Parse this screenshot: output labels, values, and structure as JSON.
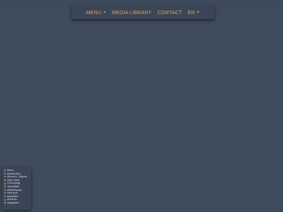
{
  "topnav": {
    "items": [
      {
        "label": "MENU",
        "has_dropdown": true
      },
      {
        "label": "MEDIA LIBRARY",
        "has_dropdown": false
      },
      {
        "label": "CONTACT",
        "has_dropdown": false
      },
      {
        "label": "EN",
        "has_dropdown": true
      }
    ]
  },
  "sidenav": {
    "items": [
      {
        "label": "Menu"
      },
      {
        "label": "Introduction"
      },
      {
        "label": "Morocco - Algeria"
      },
      {
        "label": "Open letter"
      },
      {
        "label": "Chronology"
      },
      {
        "label": "Journalists"
      },
      {
        "label": "Mediatheque"
      },
      {
        "label": "Next post"
      },
      {
        "label": "Actualités"
      },
      {
        "label": "Archives"
      },
      {
        "label": "Navigation"
      }
    ]
  },
  "colors": {
    "background": "#3d4a5b",
    "nav_background": "#3a4658",
    "accent": "#e2a25a",
    "sidenav_text": "#d9dde3"
  }
}
